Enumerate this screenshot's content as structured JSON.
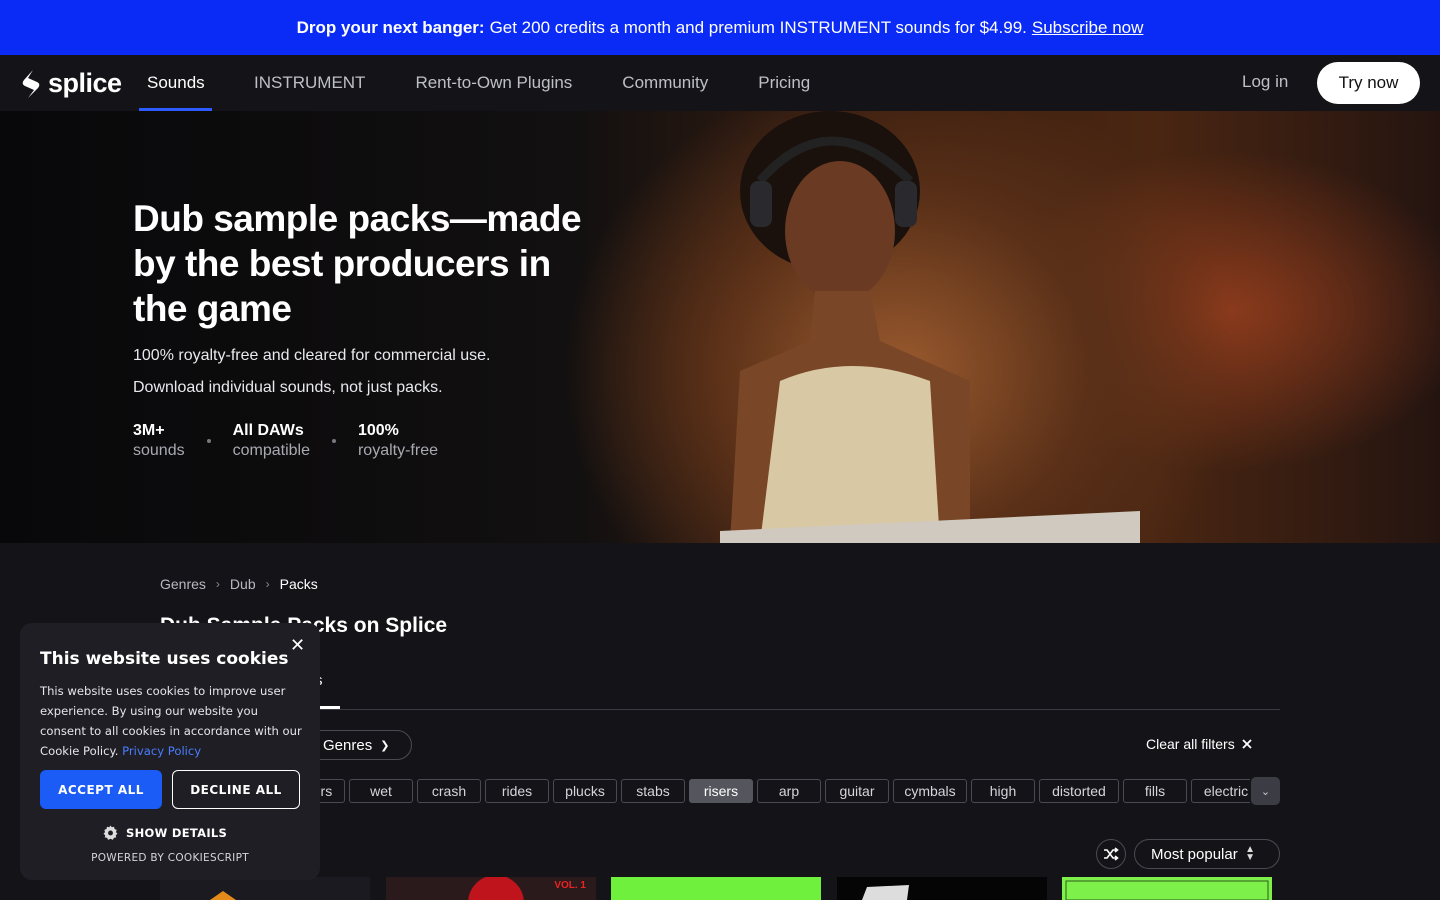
{
  "promo": {
    "bold": "Drop your next banger:",
    "text": "Get 200 credits a month and premium INSTRUMENT sounds for $4.99.",
    "link": "Subscribe now"
  },
  "nav": {
    "logo": "splice",
    "items": [
      {
        "label": "Sounds"
      },
      {
        "label": "INSTRUMENT"
      },
      {
        "label": "Rent-to-Own Plugins"
      },
      {
        "label": "Community"
      },
      {
        "label": "Pricing"
      }
    ],
    "login": "Log in",
    "try": "Try now"
  },
  "hero": {
    "title": "Dub sample packs—made by the best producers in the game",
    "sub1": "100% royalty-free and cleared for commercial use.",
    "sub2": "Download individual sounds, not just packs.",
    "stats": [
      {
        "value": "3M+",
        "label": "sounds"
      },
      {
        "value": "All DAWs",
        "label": "compatible"
      },
      {
        "value": "100%",
        "label": "royalty-free"
      }
    ]
  },
  "breadcrumb": [
    "Genres",
    "Dub",
    "Packs"
  ],
  "page_title": "Dub Sample Packs on Splice",
  "tab_active": "Packs",
  "tab_active_visible": "cks",
  "filters": {
    "genres": "Genres",
    "clear": "Clear all filters",
    "tags": [
      {
        "label": "ers",
        "selected": false
      },
      {
        "label": "wet",
        "selected": false
      },
      {
        "label": "crash",
        "selected": false
      },
      {
        "label": "rides",
        "selected": false
      },
      {
        "label": "plucks",
        "selected": false
      },
      {
        "label": "stabs",
        "selected": false
      },
      {
        "label": "risers",
        "selected": true
      },
      {
        "label": "arp",
        "selected": false
      },
      {
        "label": "guitar",
        "selected": false
      },
      {
        "label": "cymbals",
        "selected": false
      },
      {
        "label": "high",
        "selected": false
      },
      {
        "label": "distorted",
        "selected": false
      },
      {
        "label": "fills",
        "selected": false
      },
      {
        "label": "electric",
        "selected": false
      }
    ]
  },
  "sort": {
    "label": "Most popular"
  },
  "cards": [
    {
      "color": "#1a1a20",
      "label": ""
    },
    {
      "color": "#8e1a1a",
      "label": "VOL. 1"
    },
    {
      "color": "#6ef03c",
      "label": ""
    },
    {
      "color": "#050505",
      "label": ""
    },
    {
      "color": "#7ef04a",
      "label": ""
    }
  ],
  "cookie": {
    "title": "This website uses cookies",
    "body": "This website uses cookies to improve user experience. By using our website you consent to all cookies in accordance with our Cookie Policy.",
    "policy_link": "Privacy Policy",
    "accept": "ACCEPT ALL",
    "decline": "DECLINE ALL",
    "show": "SHOW DETAILS",
    "powered": "POWERED BY COOKIESCRIPT"
  },
  "colors": {
    "promo_bg": "#0a2bf5",
    "accent": "#2d5bff",
    "page_bg": "#141418",
    "cookie_accept": "#1a5cf5"
  }
}
